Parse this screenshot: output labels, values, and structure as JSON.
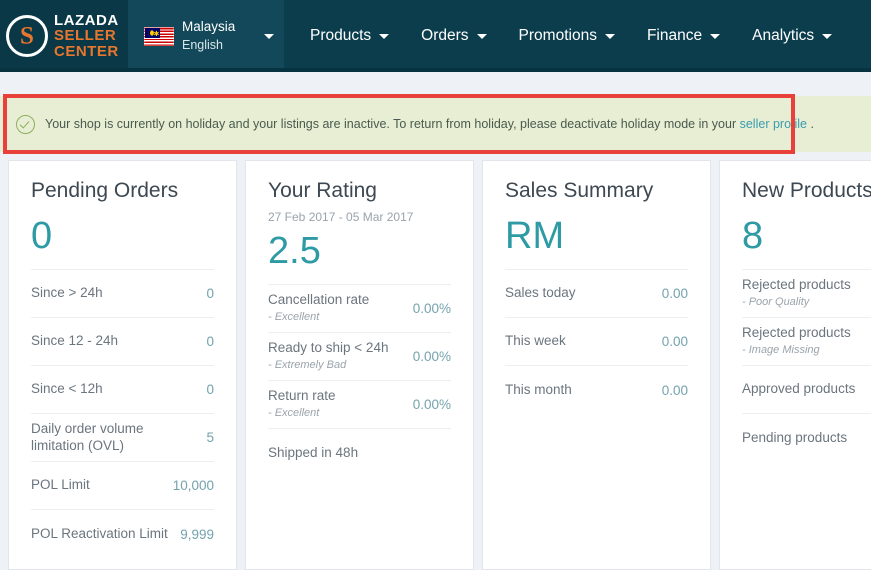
{
  "header": {
    "logo": {
      "mark_letter": "S",
      "line1": "LAZADA",
      "line2": "SELLER",
      "line3": "CENTER"
    },
    "country_selector": {
      "country": "Malaysia",
      "language": "English",
      "flag_icon": "malaysia-flag-icon",
      "caret_icon": "chevron-down-icon"
    },
    "nav": [
      {
        "label": "Products",
        "caret_icon": "chevron-down-icon"
      },
      {
        "label": "Orders",
        "caret_icon": "chevron-down-icon"
      },
      {
        "label": "Promotions",
        "caret_icon": "chevron-down-icon"
      },
      {
        "label": "Finance",
        "caret_icon": "chevron-down-icon"
      },
      {
        "label": "Analytics",
        "caret_icon": "chevron-down-icon"
      }
    ]
  },
  "alert": {
    "icon": "check-circle-icon",
    "text_before": "Your shop is currently on holiday and your listings are inactive. To return from holiday, please deactivate holiday mode in your ",
    "link_label": "seller profile",
    "text_after": " .",
    "background_color": "#e7eed4",
    "link_color": "#3a9cad",
    "annotation_border_color": "#e8403a"
  },
  "cards": [
    {
      "title": "Pending Orders",
      "subtitle": "",
      "big_value": "0",
      "rows": [
        {
          "label": "Since > 24h",
          "sub": "",
          "value": "0"
        },
        {
          "label": "Since 12 - 24h",
          "sub": "",
          "value": "0"
        },
        {
          "label": "Since < 12h",
          "sub": "",
          "value": "0"
        },
        {
          "label": "Daily order volume limitation (OVL)",
          "sub": "",
          "value": "5"
        },
        {
          "label": "POL Limit",
          "sub": "",
          "value": "10,000"
        },
        {
          "label": "POL Reactivation Limit",
          "sub": "",
          "value": "9,999"
        }
      ]
    },
    {
      "title": "Your Rating",
      "subtitle": "27 Feb 2017 - 05 Mar 2017",
      "big_value": "2.5",
      "rows": [
        {
          "label": "Cancellation rate",
          "sub": "- Excellent",
          "value": "0.00%"
        },
        {
          "label": "Ready to ship < 24h",
          "sub": "- Extremely Bad",
          "value": "0.00%"
        },
        {
          "label": "Return rate",
          "sub": "- Excellent",
          "value": "0.00%"
        },
        {
          "label": "Shipped in 48h",
          "sub": "",
          "value": ""
        }
      ]
    },
    {
      "title": "Sales Summary",
      "subtitle": "",
      "big_value": "RM",
      "rows": [
        {
          "label": "Sales today",
          "sub": "",
          "value": "0.00"
        },
        {
          "label": "This week",
          "sub": "",
          "value": "0.00"
        },
        {
          "label": "This month",
          "sub": "",
          "value": "0.00"
        }
      ]
    },
    {
      "title": "New Products",
      "subtitle": "",
      "big_value": "8",
      "rows": [
        {
          "label": "Rejected products",
          "sub": "- Poor Quality",
          "value": ""
        },
        {
          "label": "Rejected products",
          "sub": "- Image Missing",
          "value": ""
        },
        {
          "label": "Approved products",
          "sub": "",
          "value": ""
        },
        {
          "label": "Pending products",
          "sub": "",
          "value": ""
        }
      ]
    }
  ],
  "colors": {
    "header_background": "#0b3d4d",
    "logo_accent": "#e8762c",
    "teal_accent": "#2e9ba4",
    "page_background": "#eef1f5"
  }
}
